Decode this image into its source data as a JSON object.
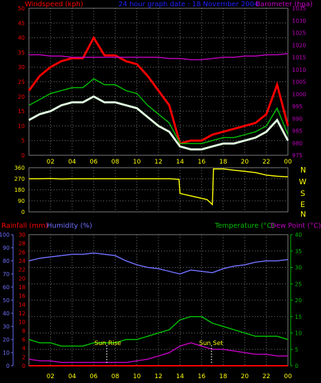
{
  "header": {
    "left_label": "Windspeed (kph)",
    "center_label": "24 hour graph date : 18 November 2004",
    "right_label": "Barometer (hpa)"
  },
  "direction_labels": [
    "N",
    "W",
    "S",
    "E",
    "N"
  ],
  "bottom_header": {
    "rainfall_label": "Rainfall (mm)",
    "humidity_label": "Humidity (%)",
    "temperature_label": "Temperature (°C)",
    "dewpoint_label": "Dew Point (°C)"
  },
  "annotations": {
    "sunrise": "Sun Rise",
    "sunset": "Sun Set"
  },
  "colors": {
    "gust": "#ff0000",
    "avg": "#00c000",
    "min": "#e0ffe0",
    "baro": "#c000c0",
    "dir": "#ffff00",
    "humidity": "#7070ff",
    "temp": "#00c000",
    "dew": "#c000c0",
    "rain": "#ff0000",
    "grid": "#808080"
  },
  "chart_data": [
    {
      "type": "line",
      "name": "wind-panel",
      "x_ticks": [
        "02",
        "04",
        "06",
        "08",
        "10",
        "12",
        "14",
        "16",
        "18",
        "20",
        "22",
        "00"
      ],
      "y_left_ticks": [
        0,
        5,
        10,
        15,
        20,
        25,
        30,
        35,
        40,
        45,
        50
      ],
      "y_left_range": [
        0,
        50
      ],
      "y_right_ticks": [
        975,
        980,
        985,
        990,
        995,
        1000,
        1005,
        1010,
        1015,
        1020,
        1025,
        1030,
        1035
      ],
      "y_right_range": [
        975,
        1035
      ],
      "hours": [
        0,
        1,
        2,
        3,
        4,
        5,
        6,
        7,
        8,
        9,
        10,
        11,
        12,
        13,
        14,
        15,
        16,
        17,
        18,
        19,
        20,
        21,
        22,
        23,
        24
      ],
      "series": [
        {
          "values": [
            22,
            27,
            30,
            32,
            33,
            33,
            40,
            34,
            34,
            32,
            31,
            27,
            22,
            17,
            4,
            5,
            5,
            7,
            8,
            9,
            10,
            11,
            14,
            24,
            10
          ]
        },
        {
          "values": [
            17,
            19,
            21,
            22,
            23,
            23,
            26,
            24,
            24,
            22,
            21,
            17,
            14,
            11,
            4,
            4,
            4,
            5,
            6,
            6,
            7,
            8,
            10,
            16,
            7
          ]
        },
        {
          "values": [
            12,
            14,
            15,
            17,
            18,
            18,
            20,
            18,
            18,
            17,
            16,
            13,
            10,
            8,
            3,
            2,
            2,
            3,
            4,
            4,
            5,
            6,
            8,
            12,
            5
          ]
        },
        {
          "values": [
            1016,
            1016,
            1015.5,
            1015.5,
            1015,
            1015,
            1015,
            1015,
            1015,
            1015,
            1015,
            1015,
            1015,
            1014.5,
            1014.5,
            1014,
            1014,
            1014.5,
            1015,
            1015,
            1015.5,
            1015.5,
            1016,
            1016,
            1016.5
          ]
        }
      ]
    },
    {
      "type": "line",
      "name": "direction-panel",
      "x_ticks": [
        "02",
        "04",
        "06",
        "08",
        "10",
        "12",
        "14",
        "16",
        "18",
        "20",
        "22",
        "00"
      ],
      "y_ticks": [
        0,
        90,
        180,
        270,
        360
      ],
      "y_range": [
        0,
        360
      ],
      "hours": [
        0,
        1,
        2,
        3,
        4,
        5,
        6,
        7,
        8,
        9,
        10,
        11,
        12,
        13,
        13.9,
        14,
        15,
        16,
        16.5,
        17,
        17.1,
        18,
        19,
        20,
        21,
        22,
        23,
        24
      ],
      "values": [
        270,
        270,
        272,
        268,
        270,
        270,
        270,
        270,
        270,
        270,
        270,
        270,
        270,
        270,
        265,
        150,
        130,
        110,
        100,
        60,
        350,
        350,
        340,
        330,
        320,
        300,
        290,
        285
      ]
    },
    {
      "type": "line",
      "name": "rain-humidity-temp-panel",
      "x_ticks": [
        "02",
        "04",
        "06",
        "08",
        "10",
        "12",
        "14",
        "16",
        "18",
        "20",
        "22",
        "00"
      ],
      "humidity_ticks": [
        0,
        10,
        20,
        30,
        40,
        50,
        60,
        70,
        80,
        90,
        100
      ],
      "rainfall_ticks": [
        0,
        2,
        4,
        6,
        8,
        10,
        12,
        14,
        16,
        18,
        20,
        22,
        24,
        26,
        28,
        30
      ],
      "temperature_ticks": [
        0,
        5,
        10,
        15,
        20,
        25,
        30,
        35,
        40
      ],
      "hours": [
        0,
        1,
        2,
        3,
        4,
        5,
        6,
        7,
        8,
        9,
        10,
        11,
        12,
        13,
        14,
        15,
        16,
        17,
        18,
        19,
        20,
        21,
        22,
        23,
        24
      ],
      "series": [
        {
          "values": [
            80,
            82,
            83,
            84,
            85,
            85,
            86,
            85,
            84,
            80,
            77,
            75,
            74,
            72,
            70,
            73,
            72,
            71,
            74,
            76,
            77,
            79,
            80,
            80,
            81
          ]
        },
        {
          "values": [
            8,
            7,
            7,
            6,
            6,
            6,
            7,
            7,
            7,
            8,
            8,
            9,
            10,
            11,
            14,
            15,
            15,
            13,
            12,
            11,
            10,
            9,
            9,
            9,
            8
          ]
        },
        {
          "values": [
            2,
            1.5,
            1.5,
            1,
            1,
            1,
            1,
            1,
            1,
            1,
            1.5,
            2,
            3,
            4,
            6,
            7,
            6,
            5,
            5,
            4.5,
            4,
            3.5,
            3.5,
            3,
            3
          ]
        },
        {
          "values": [
            0,
            0,
            0,
            0,
            0,
            0,
            0,
            0,
            0,
            0,
            0,
            0,
            0,
            0,
            0,
            0,
            0,
            0,
            0,
            0,
            0,
            0,
            0,
            0,
            0
          ]
        }
      ]
    }
  ]
}
